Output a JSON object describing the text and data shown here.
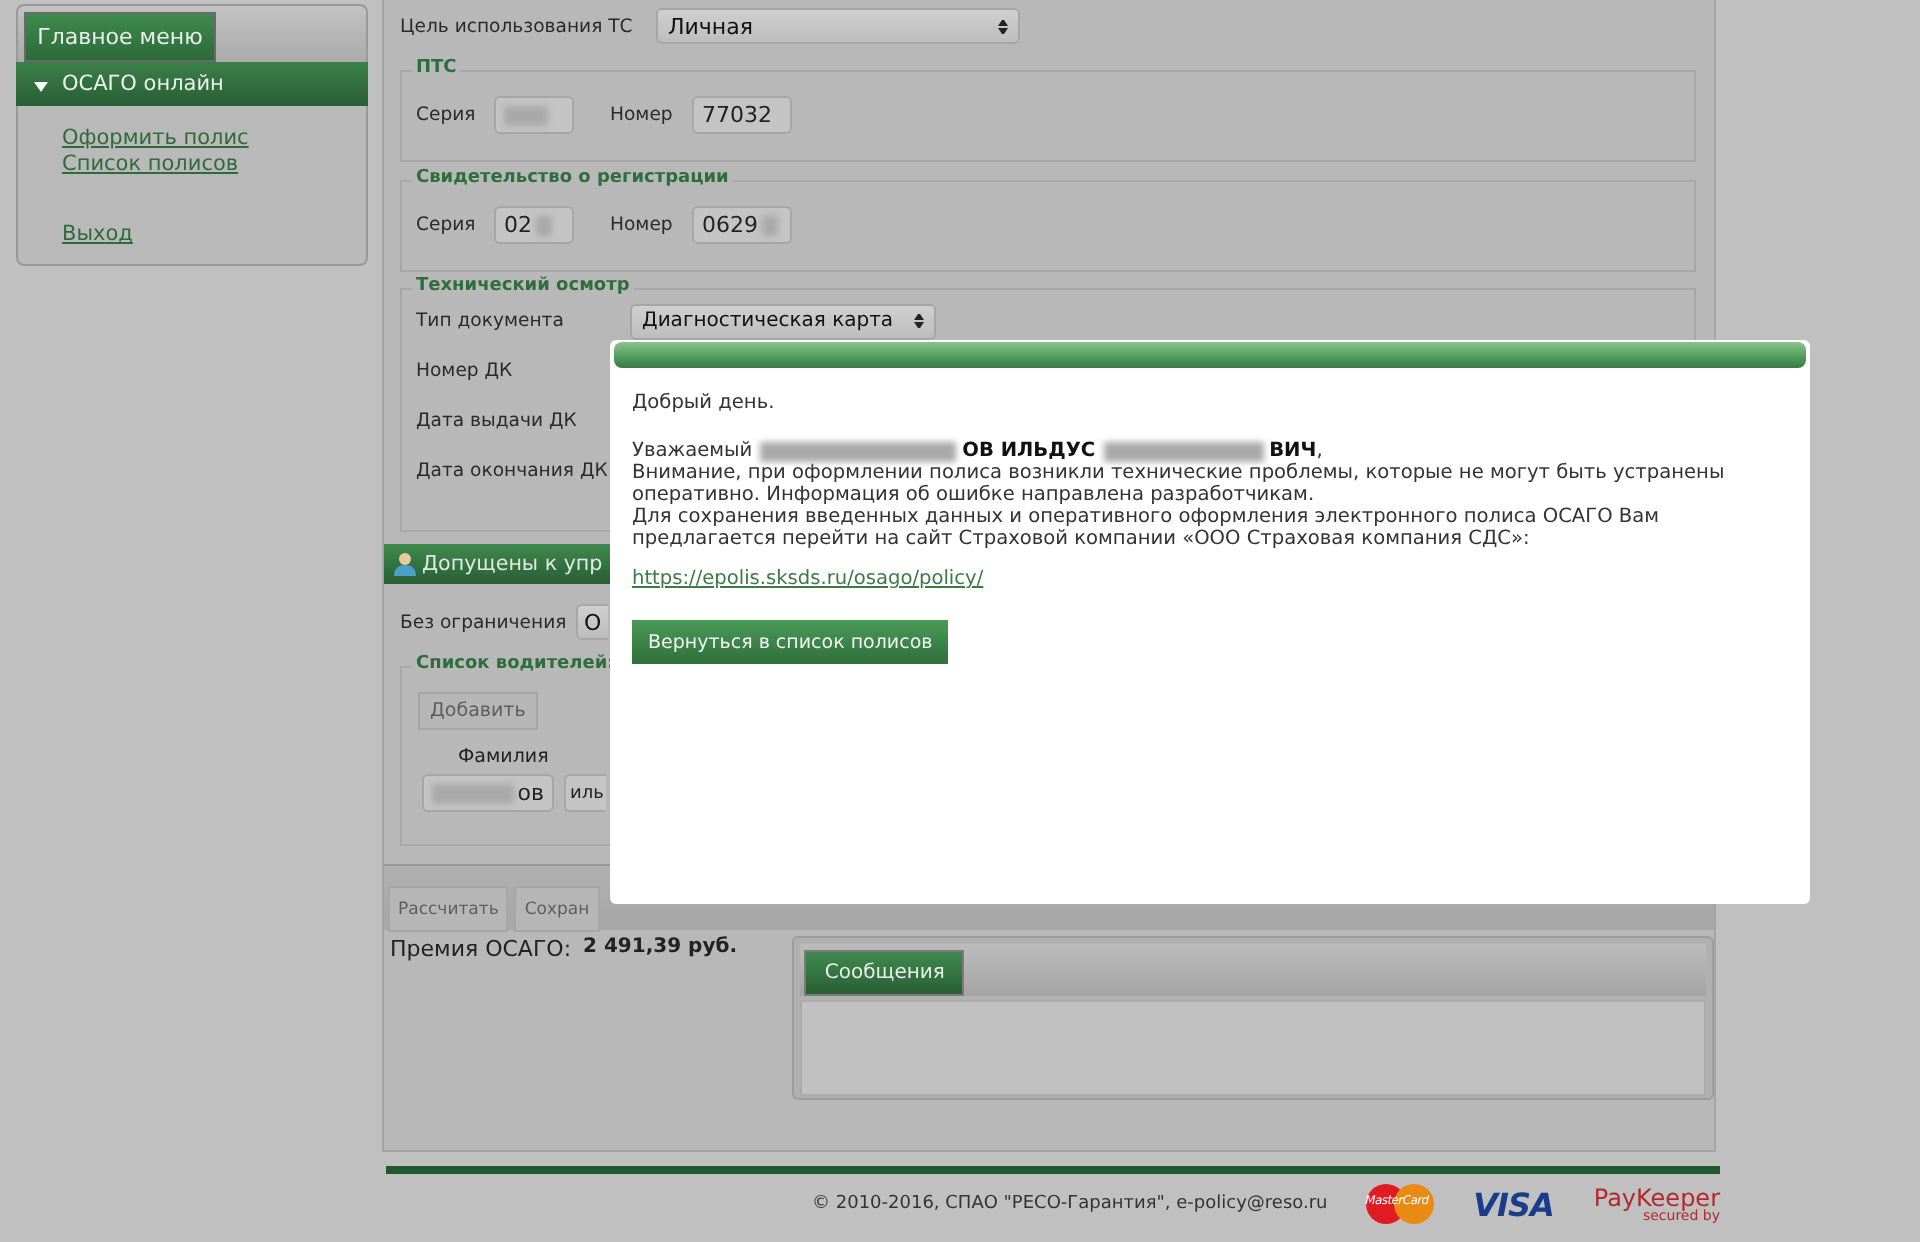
{
  "sidebar": {
    "header": "Главное меню",
    "section": {
      "label": "ОСАГО онлайн",
      "expanded": true
    },
    "links": [
      "Оформить полис",
      "Список полисов"
    ],
    "logout": "Выход"
  },
  "form": {
    "usage": {
      "label": "Цель использования ТС",
      "value": "Личная"
    },
    "pts": {
      "title": "ПТС",
      "series_label": "Серия",
      "number_label": "Номер",
      "number_value": "77032"
    },
    "registration": {
      "title": "Свидетельство о регистрации",
      "series_label": "Серия",
      "series_value": "02",
      "number_label": "Номер",
      "number_value": "0629"
    },
    "inspection": {
      "title": "Технический осмотр",
      "fields": [
        "Тип документа",
        "Номер ДК",
        "Дата выдачи ДК",
        "Дата окончания ДК"
      ],
      "doc_type": "Диагностическая карта"
    },
    "drivers": {
      "bar_title": "Допущены к упр",
      "unlimited_label": "Без ограничения",
      "unlimited_value": "О",
      "list_title": "Список водителей:",
      "add_button": {
        "label": "Добавить",
        "disabled": true
      },
      "column": "Фамилия",
      "row": [
        "ов",
        "иль"
      ]
    },
    "actions": [
      {
        "label": "Рассчитать",
        "disabled": true
      },
      {
        "label": "Сохран",
        "disabled": true
      }
    ],
    "premium": {
      "label": "Премия ОСАГО:",
      "value": "2 491,39 руб."
    },
    "messages": {
      "tab": "Сообщения",
      "selected": true
    }
  },
  "modal": {
    "greeting": "Добрый день.",
    "salutation": {
      "prefix": "Уважаемый",
      "name_parts": [
        "ОВ ИЛЬДУС",
        "ВИЧ"
      ],
      "suffix": ","
    },
    "body": [
      "Внимание, при оформлении полиса возникли технические проблемы, которые не могут быть устранены оперативно. Информация об ошибке направлена разработчикам.",
      "Для сохранения введенных данных и оперативного оформления электронного полиса ОСАГО Вам предлагается перейти на сайт Страховой компании «ООО Страховая компания СДС»:"
    ],
    "link": "https://epolis.sksds.ru/osago/policy/",
    "button": "Вернуться в список полисов"
  },
  "footer": {
    "copyright": "© 2010-2016, СПАО \"РЕСО-Гарантия\", e-policy@reso.ru",
    "logos": [
      {
        "kind": "mastercard",
        "text": "MasterCard"
      },
      {
        "kind": "visa",
        "text": "VISA"
      },
      {
        "kind": "paykeeper",
        "text": "PayKeeper",
        "subtext": "secured by"
      }
    ]
  }
}
